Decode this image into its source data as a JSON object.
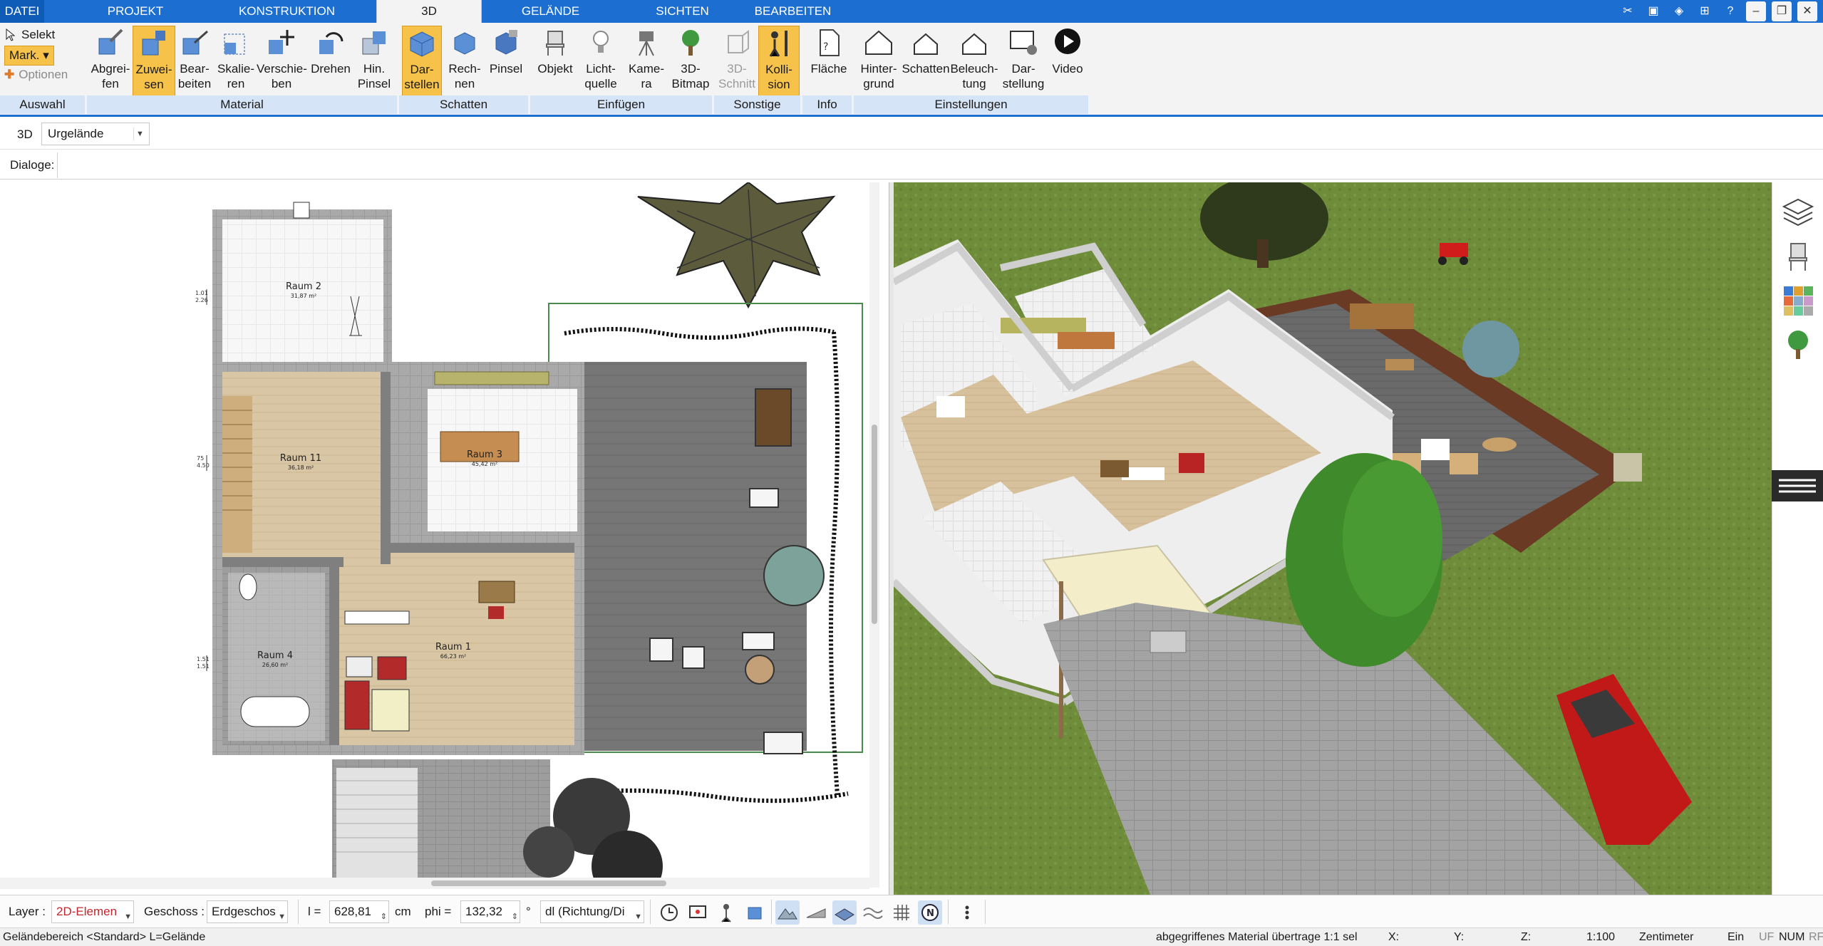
{
  "menu": {
    "tabs": [
      "DATEI",
      "PROJEKT",
      "KONSTRUKTION",
      "3D",
      "GELÄNDE",
      "SICHTEN",
      "BEARBEITEN"
    ],
    "active_tab": "3D"
  },
  "ribbon": {
    "auswahl": {
      "selekt": "Selekt",
      "mark": "Mark.",
      "optionen": "Optionen",
      "group": "Auswahl"
    },
    "material": {
      "group": "Material",
      "buttons": [
        "Abgrei-\nfen",
        "Zuwei-\nsen",
        "Bear-\nbeiten",
        "Skalie-\nren",
        "Verschie-\nben",
        "Drehen",
        "Hin.\nPinsel"
      ]
    },
    "schatten": {
      "group": "Schatten",
      "buttons": [
        "Dar-\nstellen",
        "Rech-\nnen",
        "Pinsel"
      ]
    },
    "einfuegen": {
      "group": "Einfügen",
      "buttons": [
        "Objekt",
        "Licht-\nquelle",
        "Kame-\nra",
        "3D-\nBitmap"
      ]
    },
    "sonstige": {
      "group": "Sonstige",
      "buttons": [
        "3D-\nSchnitt",
        "Kolli-\nsion"
      ]
    },
    "info": {
      "group": "Info",
      "buttons": [
        "Fläche"
      ]
    },
    "einstellungen": {
      "group": "Einstellungen",
      "buttons": [
        "Hinter-\ngrund",
        "Schatten",
        "Beleuch-\ntung",
        "Dar-\nstellung",
        "Video"
      ]
    }
  },
  "toolbar": {
    "mode_label": "3D",
    "terrain_value": "Urgelände",
    "dialoge_label": "Dialoge:"
  },
  "plan": {
    "rooms": [
      {
        "name": "Raum 2",
        "area": "31,87 m²"
      },
      {
        "name": "Raum 11",
        "area": "36,18 m²"
      },
      {
        "name": "Raum 3",
        "area": "45,42 m²"
      },
      {
        "name": "Raum 1",
        "area": "66,23 m²"
      },
      {
        "name": "Raum 4",
        "area": "26,60 m²"
      }
    ],
    "dimensions": [
      "1.01",
      "2.26",
      "75",
      "4.50",
      "1.51",
      "1.51"
    ]
  },
  "bottom": {
    "layer_label": "Layer :",
    "layer_value": "2D-Elemen",
    "geschoss_label": "Geschoss :",
    "geschoss_value": "Erdgeschos",
    "l_label": "l =",
    "l_value": "628,81",
    "l_unit": "cm",
    "phi_label": "phi =",
    "phi_value": "132,32",
    "phi_unit": "°",
    "dl_value": "dl (Richtung/Di"
  },
  "status": {
    "left": "Geländebereich <Standard> L=Gelände",
    "message": "abgegriffenes Material übertrage 1:1 sel",
    "x": "X:",
    "y": "Y:",
    "z": "Z:",
    "scale": "1:100",
    "unit": "Zentimeter",
    "ein": "Ein",
    "uf": "UF",
    "num": "NUM",
    "rf": "RF"
  },
  "colors": {
    "accent": "#1c6fd1",
    "active_button": "#f6c24a",
    "group_bar": "#d5e4f6",
    "grass": "#6f8c3b",
    "deck": "#6e6e6e"
  }
}
